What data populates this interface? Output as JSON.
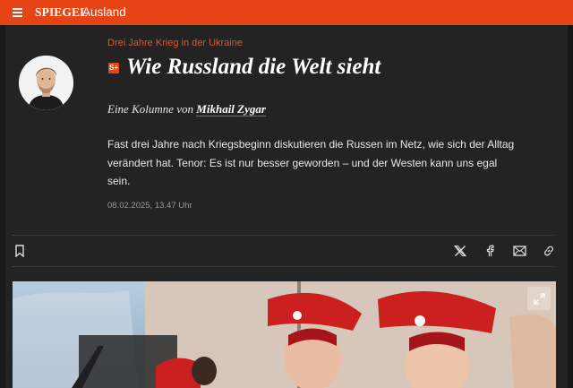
{
  "header": {
    "logo": "SPIEGEL",
    "section": "Ausland"
  },
  "article": {
    "kicker": "Drei Jahre Krieg in der Ukraine",
    "badge": "S+",
    "headline": "Wie Russland die Welt sieht",
    "byline_prefix": "Eine Kolumne von",
    "author": "Mikhail Zygar",
    "teaser": "Fast drei Jahre nach Kriegsbeginn diskutieren die Russen im Netz, wie sich der Alltag verändert hat. Tenor: Es ist nur besser geworden – und der Westen kann uns egal sein.",
    "date": "08.02.2025, 13.47 Uhr"
  },
  "toolbar": {
    "icons": [
      "bookmark-icon",
      "x-share-icon",
      "facebook-share-icon",
      "email-share-icon",
      "copy-link-icon"
    ]
  },
  "colors": {
    "brand": "#e64415",
    "background": "#232323",
    "kicker": "#e0552e"
  }
}
